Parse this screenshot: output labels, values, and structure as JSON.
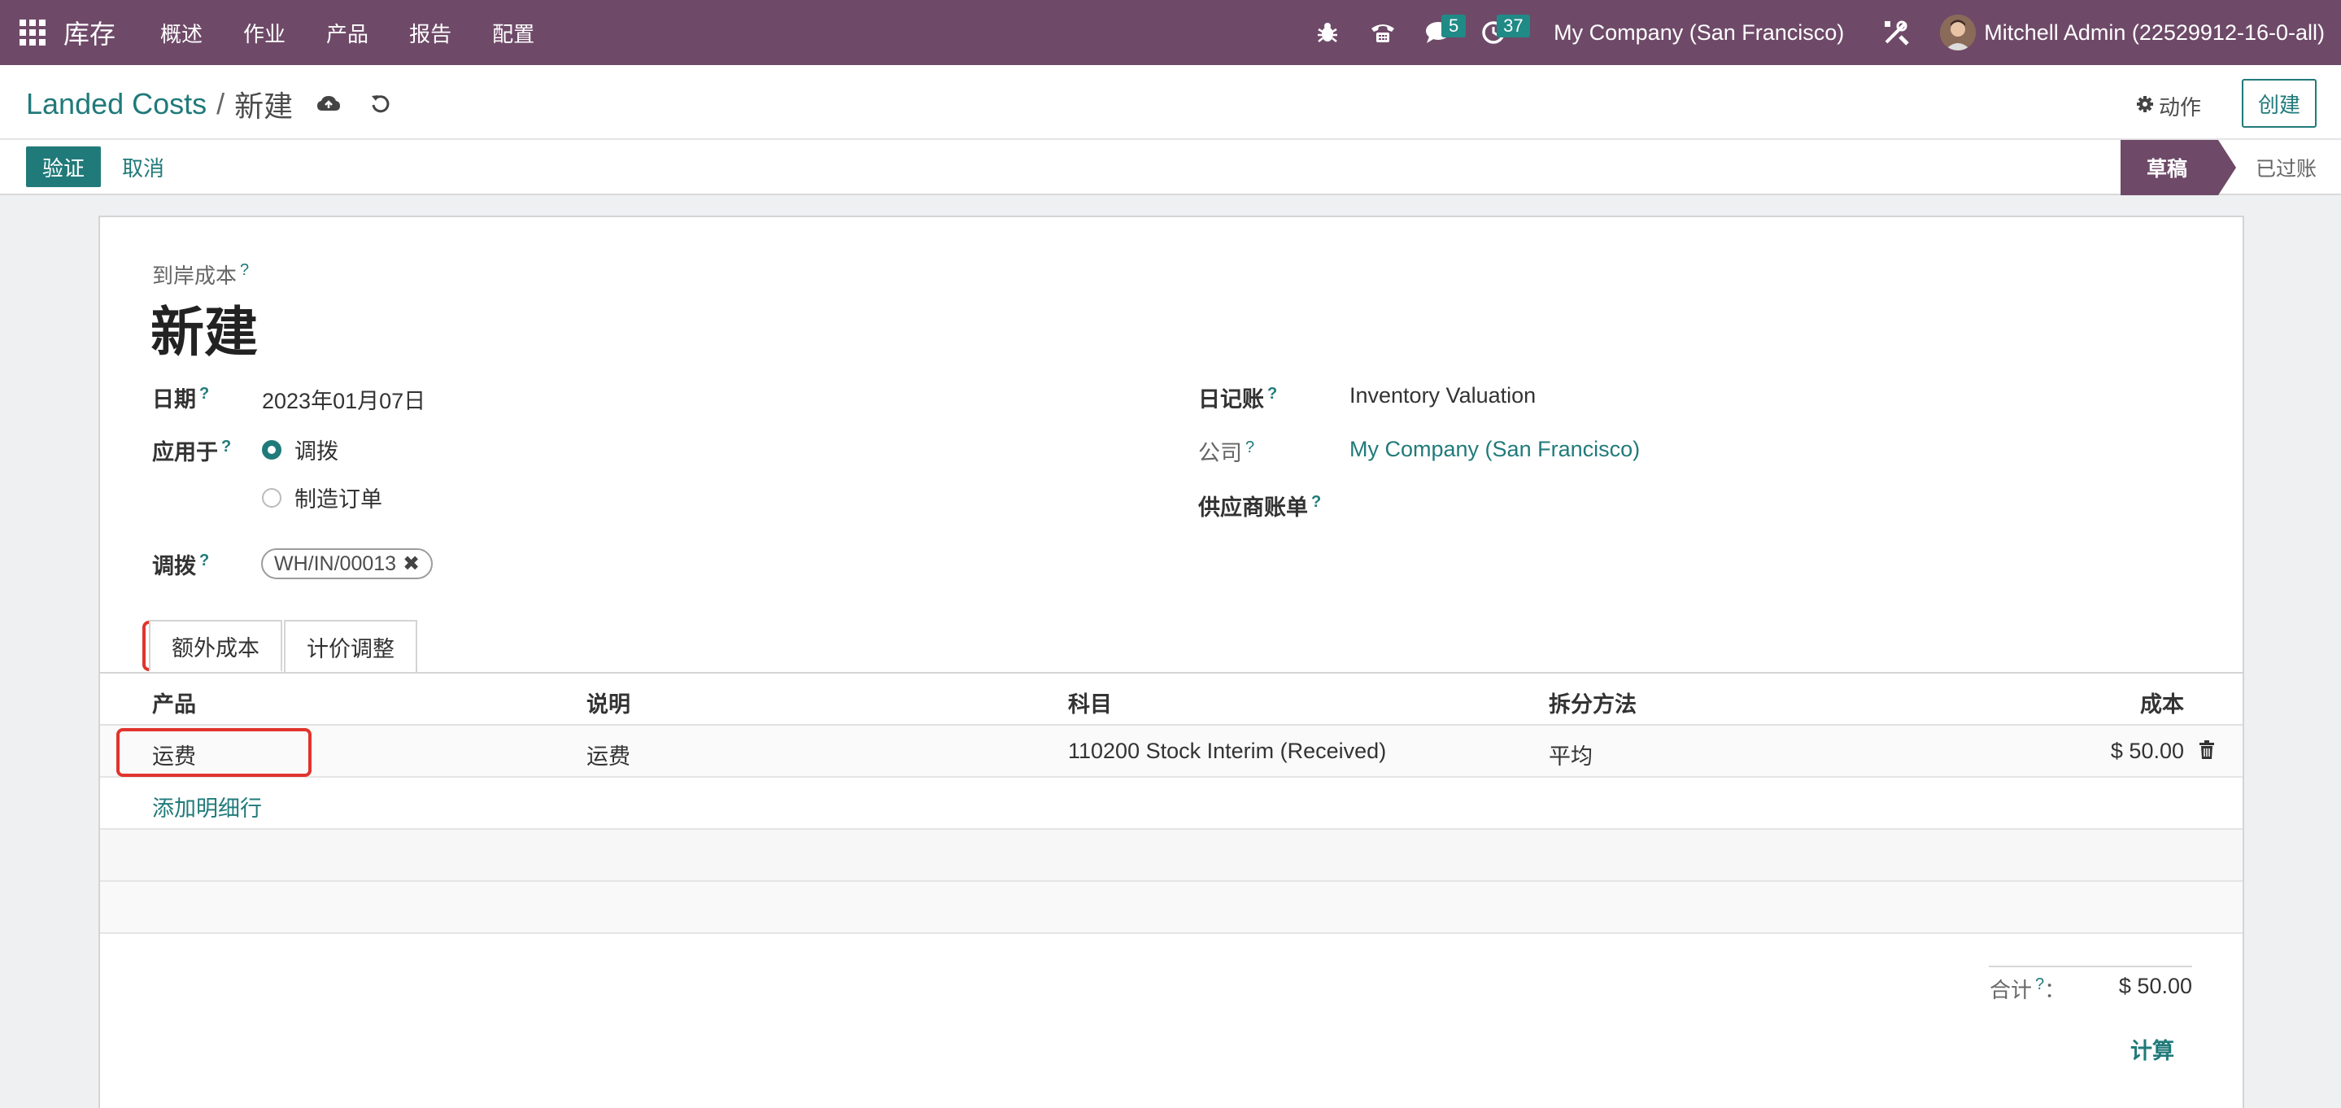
{
  "navbar": {
    "app_name": "库存",
    "menu": [
      "概述",
      "作业",
      "产品",
      "报告",
      "配置"
    ],
    "messages_count": "5",
    "activities_count": "37",
    "company": "My Company (San Francisco)",
    "user": "Mitchell Admin (22529912-16-0-all)",
    "bg_color": "#6e4a68"
  },
  "control": {
    "breadcrumb_parent": "Landed Costs",
    "breadcrumb_sep": "/",
    "breadcrumb_current": "新建",
    "action_label": "动作",
    "create_label": "创建",
    "validate_label": "验证",
    "cancel_label": "取消",
    "status_draft": "草稿",
    "status_posted": "已过账"
  },
  "form": {
    "section_label": "到岸成本",
    "help": "?",
    "title": "新建",
    "date_label": "日期",
    "date_value": "2023年01月07日",
    "apply_label": "应用于",
    "apply_options": [
      "调拨",
      "制造订单"
    ],
    "transfers_label": "调拨",
    "transfer_tag": "WH/IN/00013",
    "journal_label": "日记账",
    "journal_value": "Inventory Valuation",
    "company_label": "公司",
    "company_value": "My Company (San Francisco)",
    "vendor_bill_label": "供应商账单",
    "tabs": [
      "额外成本",
      "计价调整"
    ],
    "table_headers": {
      "product": "产品",
      "description": "说明",
      "account": "科目",
      "split_method": "拆分方法",
      "cost": "成本"
    },
    "rows": [
      {
        "product": "运费",
        "description": "运费",
        "account": "110200 Stock Interim (Received)",
        "split_method": "平均",
        "cost": "$ 50.00"
      }
    ],
    "add_line": "添加明细行",
    "total_label": "合计",
    "total_colon": "：",
    "total_value": "$ 50.00",
    "compute_label": "计算"
  },
  "colors": {
    "accent": "#217a7a",
    "highlight": "#e0342d"
  }
}
